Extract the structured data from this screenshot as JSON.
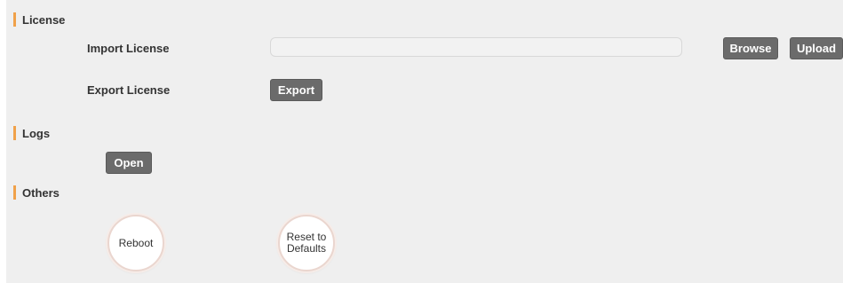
{
  "license": {
    "title": "License",
    "import_label": "Import License",
    "import_value": "",
    "browse_label": "Browse",
    "upload_label": "Upload",
    "export_label": "Export License",
    "export_button": "Export"
  },
  "logs": {
    "title": "Logs",
    "open_button": "Open"
  },
  "others": {
    "title": "Others",
    "reboot_button": "Reboot",
    "reset_button_line1": "Reset to",
    "reset_button_line2": "Defaults"
  },
  "colors": {
    "accent_bar": "#f0a14a",
    "button_bg": "#6b6b6b",
    "panel_bg": "#efefef"
  }
}
